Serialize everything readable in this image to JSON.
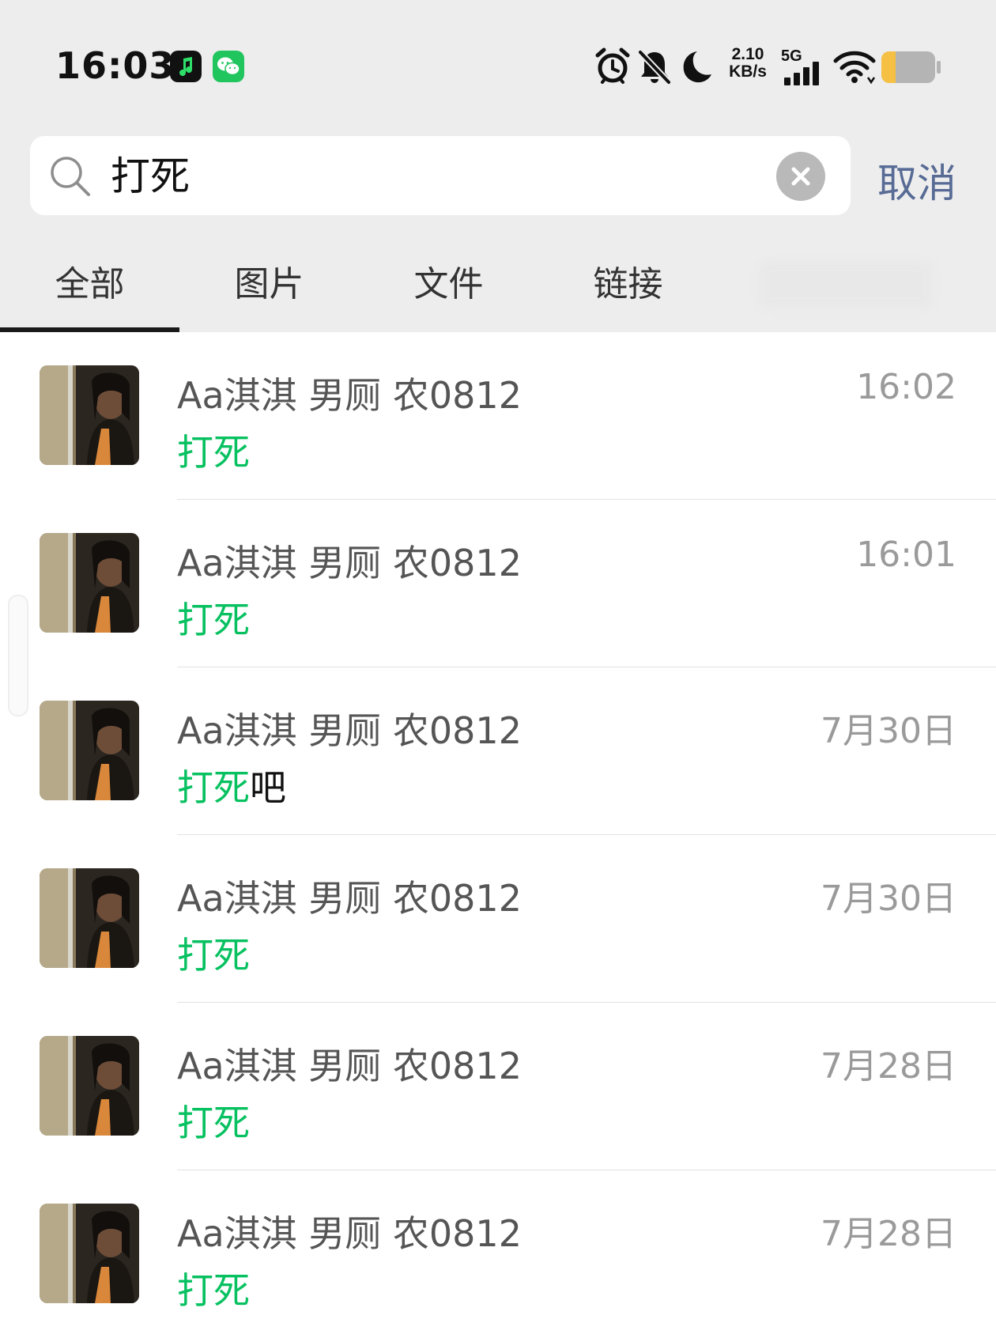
{
  "status_bar": {
    "time": "16:03",
    "net_speed_value": "2.10",
    "net_speed_unit": "KB/s",
    "network_type": "5G",
    "icons": [
      "music-app-icon",
      "wechat-icon",
      "alarm-icon",
      "mute-icon",
      "moon-icon",
      "signal-icon",
      "wifi-icon",
      "battery-icon"
    ],
    "battery_level": 0.25
  },
  "search": {
    "query": "打死",
    "cancel_label": "取消"
  },
  "tabs": [
    {
      "label": "全部",
      "active": true
    },
    {
      "label": "图片",
      "active": false
    },
    {
      "label": "文件",
      "active": false
    },
    {
      "label": "链接",
      "active": false
    }
  ],
  "colors": {
    "highlight": "#07c160",
    "link_blue": "#576b95",
    "background": "#ededed"
  },
  "results": [
    {
      "name": "Aa淇淇 男厕 农0812",
      "match": "打死",
      "rest": "",
      "time": "16:02"
    },
    {
      "name": "Aa淇淇 男厕 农0812",
      "match": "打死",
      "rest": "",
      "time": "16:01"
    },
    {
      "name": "Aa淇淇 男厕 农0812",
      "match": "打死",
      "rest": "吧",
      "time": "7月30日"
    },
    {
      "name": "Aa淇淇 男厕 农0812",
      "match": "打死",
      "rest": "",
      "time": "7月30日"
    },
    {
      "name": "Aa淇淇 男厕 农0812",
      "match": "打死",
      "rest": "",
      "time": "7月28日"
    },
    {
      "name": "Aa淇淇 男厕 农0812",
      "match": "打死",
      "rest": "",
      "time": "7月28日"
    }
  ]
}
